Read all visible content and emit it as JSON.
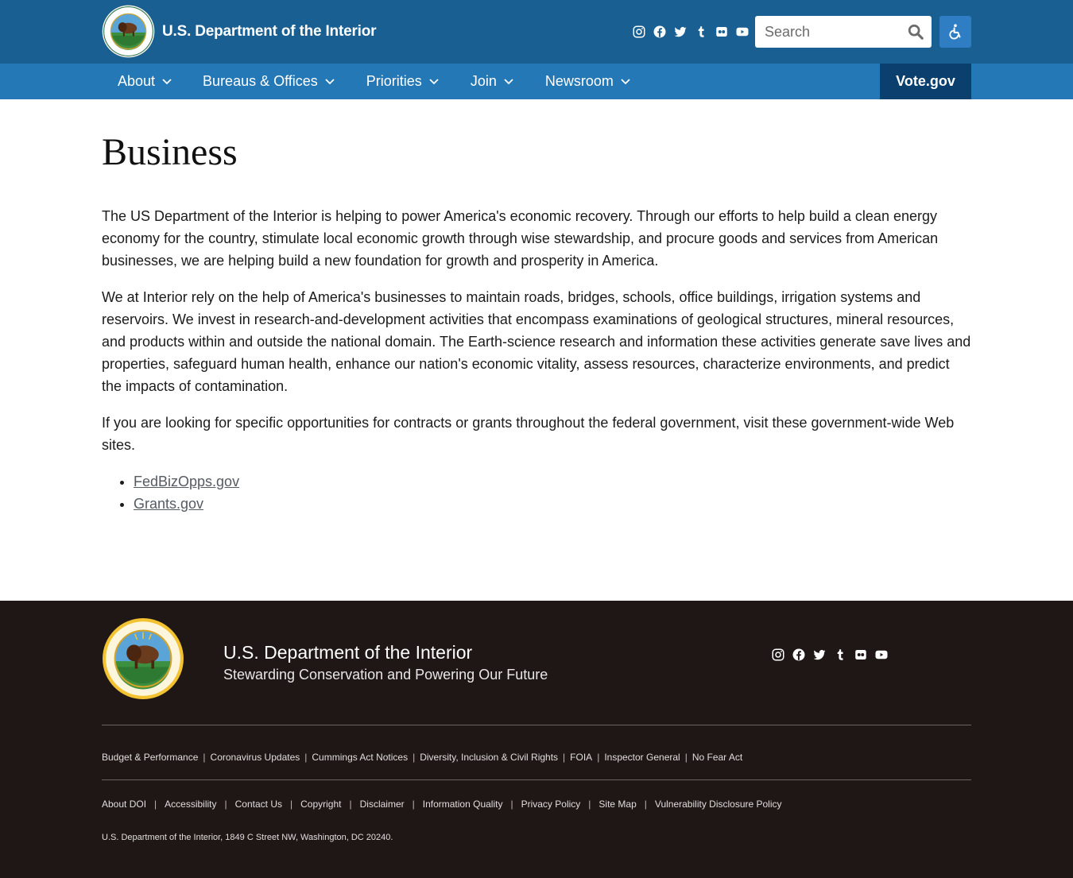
{
  "header": {
    "site_name": "U.S. Department of the Interior",
    "search_placeholder": "Search",
    "social": [
      "instagram-icon",
      "facebook-icon",
      "twitter-icon",
      "tumblr-icon",
      "flickr-icon",
      "youtube-icon"
    ],
    "colors": {
      "topbar": "#1a5f92",
      "navbar": "#2378b5",
      "vote": "#0b3f6e"
    }
  },
  "nav": {
    "items": [
      {
        "label": "About"
      },
      {
        "label": "Bureaus & Offices"
      },
      {
        "label": "Priorities"
      },
      {
        "label": "Join"
      },
      {
        "label": "Newsroom"
      }
    ],
    "cta_label": "Vote.gov"
  },
  "main": {
    "title": "Business",
    "paragraphs": [
      "The US Department of the Interior is helping to power America's economic recovery. Through our efforts to help build a clean energy economy for the country, stimulate local economic growth through wise stewardship, and procure goods and services from American businesses, we are helping build a new foundation for growth and prosperity in America.",
      "We at Interior rely on the help of America's businesses to maintain roads, bridges, schools, office buildings, irrigation systems and reservoirs. We invest in research-and-development activities that encompass examinations of geological structures, mineral resources, and products within and outside the national domain. The Earth-science research and information these activities generate save lives and properties, safeguard human health, enhance our nation's economic vitality, assess resources, characterize environments, and predict the impacts of contamination.",
      "If you are looking for specific opportunities for contracts or grants throughout the federal government, visit these government-wide Web sites."
    ],
    "links": [
      "FedBizOpps.gov",
      "Grants.gov"
    ]
  },
  "footer": {
    "title": "U.S. Department of the Interior",
    "tagline": "Stewarding Conservation and Powering Our Future",
    "links_row1": [
      "Budget & Performance",
      "Coronavirus Updates",
      "Cummings Act Notices",
      "Diversity, Inclusion & Civil Rights",
      "FOIA",
      "Inspector General",
      "No Fear Act"
    ],
    "links_row2": [
      "About DOI",
      "Accessibility",
      "Contact Us",
      "Copyright",
      "Disclaimer",
      "Information Quality",
      "Privacy Policy",
      "Site Map",
      "Vulnerability Disclosure Policy"
    ],
    "address": "U.S. Department of the Interior, 1849 C Street NW, Washington, DC 20240.",
    "colors": {
      "background": "#1f1716"
    }
  }
}
